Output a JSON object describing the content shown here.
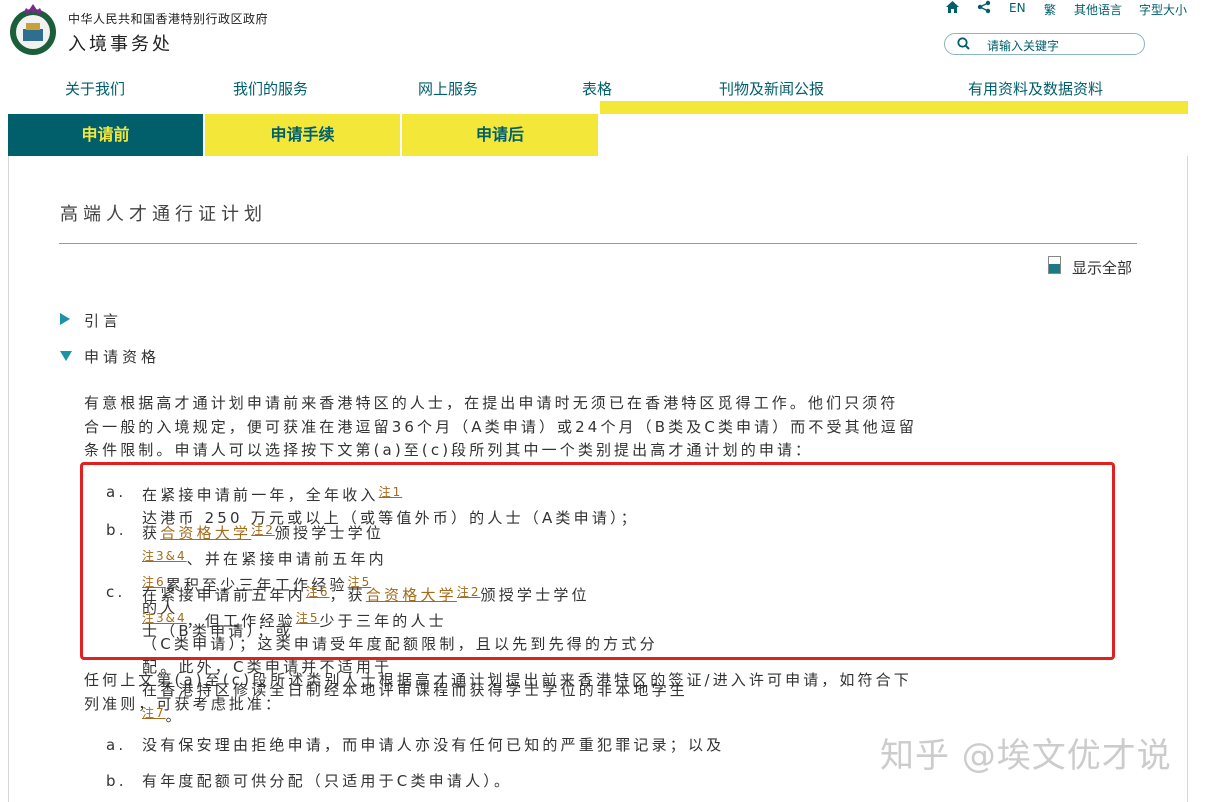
{
  "header": {
    "gov_name": "中华人民共和国香港特别行政区政府",
    "dept_name": "入境事务处"
  },
  "utility": {
    "home_icon": "home-icon",
    "share_icon": "share-icon",
    "lang_en": "EN",
    "lang_trad": "繁",
    "other_lang": "其他语言",
    "font_size": "字型大小"
  },
  "search": {
    "placeholder": "请输入关键字",
    "icon": "search-icon"
  },
  "nav": {
    "items": [
      "关于我们",
      "我们的服务",
      "网上服务",
      "表格",
      "刊物及新闻公报",
      "有用资料及数据资料"
    ]
  },
  "tabs": [
    "申请前",
    "申请手续",
    "申请后"
  ],
  "colors": {
    "teal": "#005f6b",
    "yellow": "#f3e83a",
    "note": "#a36b1a",
    "highlight": "#e0211f"
  },
  "page": {
    "title": "高端人才通行证计划",
    "show_all": "显示全部",
    "accordion": [
      "引言",
      "申请资格"
    ]
  },
  "content": {
    "intro": [
      "有意根据高才通计划申请前来香港特区的人士，在提出申请时无须已在香港特区觅得工作。他们只须符",
      "合一般的入境规定，便可获准在港逗留36个月（A类申请）或24个月（B类及C类申请）而不受其他逗留",
      "条件限制。申请人可以选择按下文第(a)至(c)段所列其中一个类别提出高才通计划的申请："
    ],
    "a": {
      "marker": "a.",
      "t1": "在紧接申请前一年，全年收入",
      "n1": "注1",
      "t2": "达港币 250 万元或以上（或等值外币）的人士（A类申请）；"
    },
    "b": {
      "marker": "b.",
      "t1": "获",
      "l1": "合资格大学",
      "n1": "注2",
      "t2": "颁授学士学位",
      "n2": "注3&4",
      "t3": "、并在紧接申请前五年内",
      "n3": "注6",
      "t4": "累积至少三年工作经验",
      "n4": "注5",
      "t5": "的人",
      "line2": "士（B类申请）；或"
    },
    "c": {
      "marker": "c.",
      "t1": "在紧接申请前五年内",
      "n1": "注6",
      "t2": "，获",
      "l1": "合资格大学",
      "n2": "注2",
      "t3": "颁授学士学位",
      "n3": "注3&4",
      "t4": "，但工作经验",
      "n4": "注5",
      "t5": "少于三年的人士",
      "line2": "（C类申请）；这类申请受年度配额限制，且以先到先得的方式分配。此外，C类申请并不适用于",
      "line3a": "在香港特区修读全日制经本地评审课程而获得学士学位的非本地学生",
      "n5": "注7",
      "line3b": "。"
    },
    "criteria_intro": [
      "任何上文第(a)至(c)段所述类别人士根据高才通计划提出前来香港特区的签证/进入许可申请，如符合下",
      "列准则，可获考虑批准："
    ],
    "criteria": [
      {
        "marker": "a.",
        "text": "没有保安理由拒绝申请，而申请人亦没有任何已知的严重犯罪记录；以及"
      },
      {
        "marker": "b.",
        "text": "有年度配额可供分配（只适用于C类申请人）。"
      }
    ]
  },
  "watermark": "知乎 @埃文优才说"
}
